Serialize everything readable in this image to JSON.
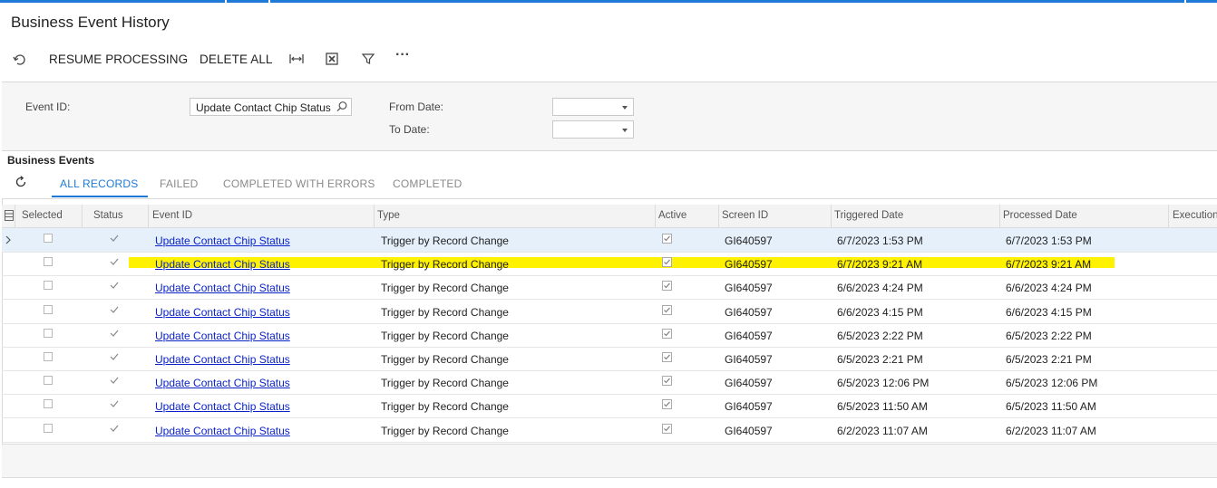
{
  "page": {
    "title": "Business Event History"
  },
  "toolbar": {
    "resume_label": "RESUME PROCESSING",
    "delete_all_label": "DELETE ALL",
    "more_label": "···"
  },
  "filters": {
    "event_id_label": "Event ID:",
    "event_id_value": "Update Contact Chip Status",
    "from_date_label": "From Date:",
    "from_date_value": "",
    "to_date_label": "To Date:",
    "to_date_value": ""
  },
  "section": {
    "title": "Business Events"
  },
  "tabs": [
    {
      "label": "ALL RECORDS",
      "active": true
    },
    {
      "label": "FAILED",
      "active": false
    },
    {
      "label": "COMPLETED WITH ERRORS",
      "active": false
    },
    {
      "label": "COMPLETED",
      "active": false
    }
  ],
  "grid": {
    "columns": [
      "Selected",
      "Status",
      "Event ID",
      "Type",
      "Active",
      "Screen ID",
      "Triggered Date",
      "Processed Date",
      "Execution"
    ],
    "rows": [
      {
        "event_id": "Update Contact Chip Status",
        "type": "Trigger by Record Change",
        "screen_id": "GI640597",
        "triggered": "6/7/2023 1:53 PM",
        "processed": "6/7/2023 1:53 PM"
      },
      {
        "event_id": "Update Contact Chip Status",
        "type": "Trigger by Record Change",
        "screen_id": "GI640597",
        "triggered": "6/7/2023 9:21 AM",
        "processed": "6/7/2023 9:21 AM"
      },
      {
        "event_id": "Update Contact Chip Status",
        "type": "Trigger by Record Change",
        "screen_id": "GI640597",
        "triggered": "6/6/2023 4:24 PM",
        "processed": "6/6/2023 4:24 PM"
      },
      {
        "event_id": "Update Contact Chip Status",
        "type": "Trigger by Record Change",
        "screen_id": "GI640597",
        "triggered": "6/6/2023 4:15 PM",
        "processed": "6/6/2023 4:15 PM"
      },
      {
        "event_id": "Update Contact Chip Status",
        "type": "Trigger by Record Change",
        "screen_id": "GI640597",
        "triggered": "6/5/2023 2:22 PM",
        "processed": "6/5/2023 2:22 PM"
      },
      {
        "event_id": "Update Contact Chip Status",
        "type": "Trigger by Record Change",
        "screen_id": "GI640597",
        "triggered": "6/5/2023 2:21 PM",
        "processed": "6/5/2023 2:21 PM"
      },
      {
        "event_id": "Update Contact Chip Status",
        "type": "Trigger by Record Change",
        "screen_id": "GI640597",
        "triggered": "6/5/2023 12:06 PM",
        "processed": "6/5/2023 12:06 PM"
      },
      {
        "event_id": "Update Contact Chip Status",
        "type": "Trigger by Record Change",
        "screen_id": "GI640597",
        "triggered": "6/5/2023 11:50 AM",
        "processed": "6/5/2023 11:50 AM"
      },
      {
        "event_id": "Update Contact Chip Status",
        "type": "Trigger by Record Change",
        "screen_id": "GI640597",
        "triggered": "6/2/2023 11:07 AM",
        "processed": "6/2/2023 11:07 AM"
      }
    ]
  },
  "colors": {
    "accent": "#1e7ad6",
    "link": "#0b22c9",
    "highlight": "#fff200",
    "selected_row": "#e5f0fb"
  },
  "icons": [
    "undo-icon",
    "fit-columns-icon",
    "excel-export-icon",
    "filter-icon",
    "more-icon",
    "search-icon",
    "refresh-icon",
    "row-arrow-icon",
    "checkmark-icon"
  ]
}
